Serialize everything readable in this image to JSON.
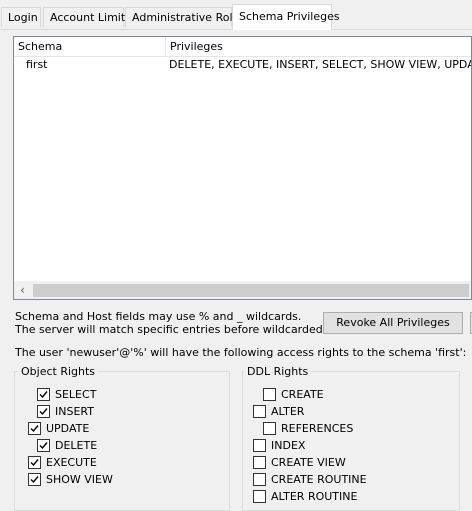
{
  "tabs": [
    {
      "label": "Login"
    },
    {
      "label": "Account Limits"
    },
    {
      "label": "Administrative Roles"
    },
    {
      "label": "Schema Privileges"
    }
  ],
  "table": {
    "columns": [
      "Schema",
      "Privileges"
    ],
    "rows": [
      {
        "schema": "first",
        "privileges": "DELETE, EXECUTE, INSERT, SELECT, SHOW VIEW, UPDATE"
      }
    ]
  },
  "notes": {
    "line1": "Schema and Host fields may use % and _ wildcards.",
    "line2": "The server will match specific entries before wildcarded ones.",
    "access": "The user 'newuser'@'%' will have the following access rights to the schema 'first':"
  },
  "revoke_button": "Revoke All Privileges",
  "object_rights": {
    "title": "Object Rights",
    "items": [
      {
        "label": "SELECT",
        "checked": true
      },
      {
        "label": "INSERT",
        "checked": true
      },
      {
        "label": "UPDATE",
        "checked": true
      },
      {
        "label": "DELETE",
        "checked": true
      },
      {
        "label": "EXECUTE",
        "checked": true
      },
      {
        "label": "SHOW VIEW",
        "checked": true
      }
    ]
  },
  "ddl_rights": {
    "title": "DDL Rights",
    "items": [
      {
        "label": "CREATE",
        "checked": false
      },
      {
        "label": "ALTER",
        "checked": false
      },
      {
        "label": "REFERENCES",
        "checked": false
      },
      {
        "label": "INDEX",
        "checked": false
      },
      {
        "label": "CREATE VIEW",
        "checked": false
      },
      {
        "label": "CREATE ROUTINE",
        "checked": false
      },
      {
        "label": "ALTER ROUTINE",
        "checked": false
      }
    ]
  }
}
